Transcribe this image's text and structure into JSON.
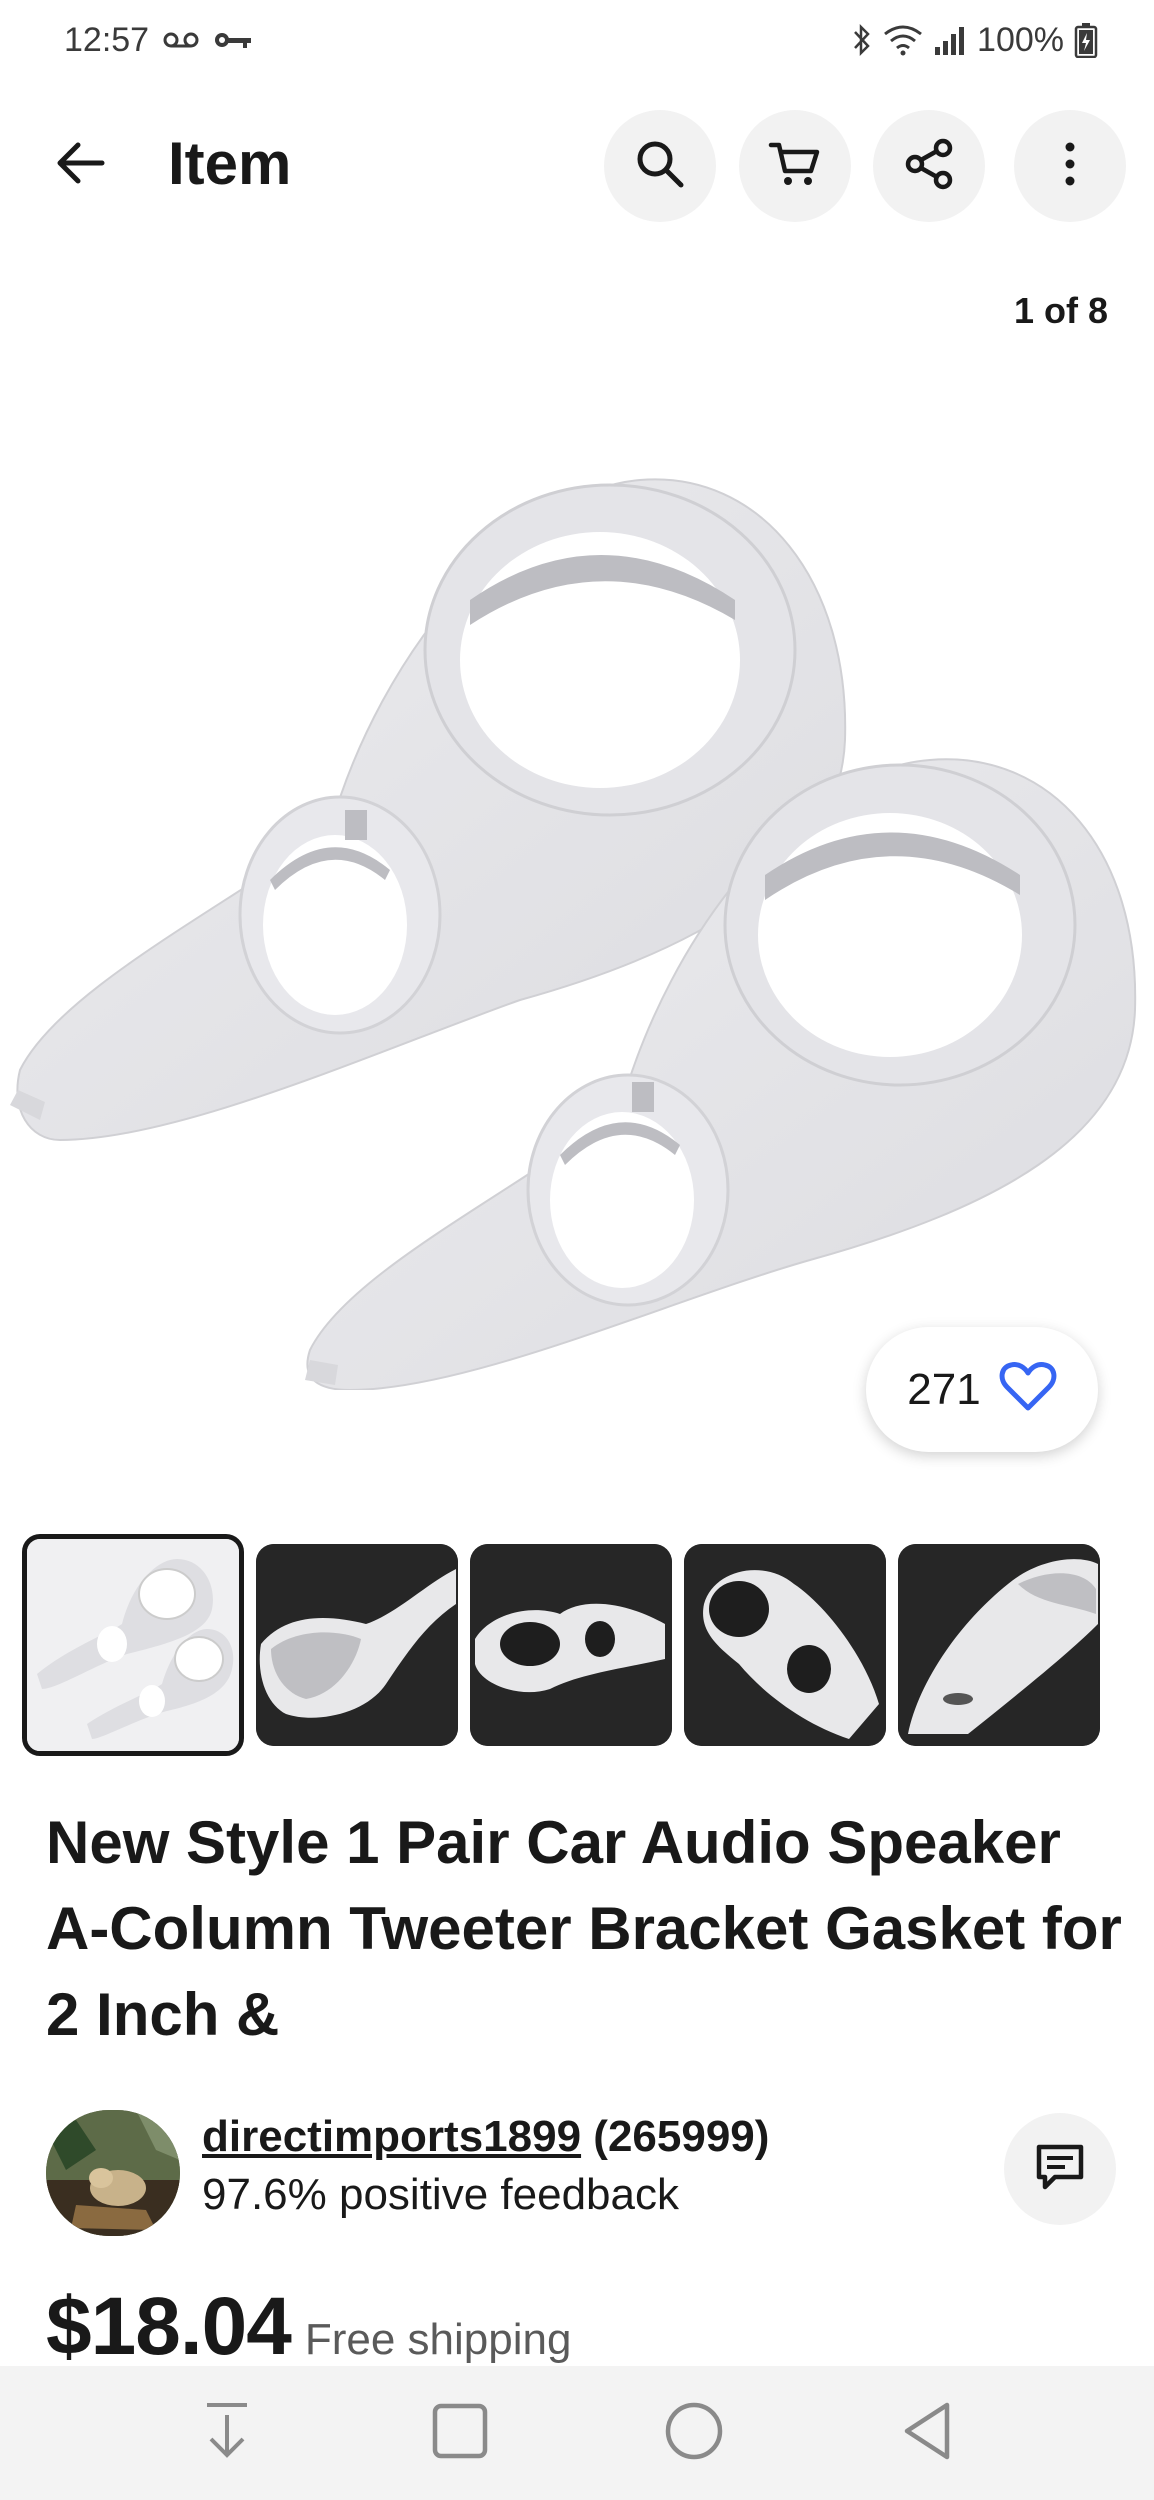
{
  "status_bar": {
    "time": "12:57",
    "battery": "100%",
    "icons": [
      "voicemail-icon",
      "key-icon",
      "bluetooth-icon",
      "wifi-icon",
      "signal-icon",
      "battery-icon"
    ]
  },
  "header": {
    "title": "Item",
    "icons": [
      "back-arrow-icon",
      "search-icon",
      "cart-icon",
      "share-icon",
      "more-vert-icon"
    ]
  },
  "gallery": {
    "counter": "1 of 8",
    "watch_count": "271",
    "thumbnail_count": 5
  },
  "product": {
    "title": "New Style 1 Pair Car Audio Speaker A-Column Tweeter Bracket Gasket for 2 Inch &"
  },
  "seller": {
    "name": "directimports1899",
    "score": "(265999)",
    "feedback": "97.6% positive feedback"
  },
  "pricing": {
    "price": "$18.04",
    "shipping": "Free shipping"
  },
  "nav_bar": {
    "icons": [
      "download-icon",
      "recents-icon",
      "home-icon",
      "back-icon"
    ]
  },
  "colors": {
    "accent_blue": "#3665f3",
    "text_primary": "#191919",
    "button_bg": "#f2f2f2",
    "nav_bg": "#f3f3f3"
  }
}
